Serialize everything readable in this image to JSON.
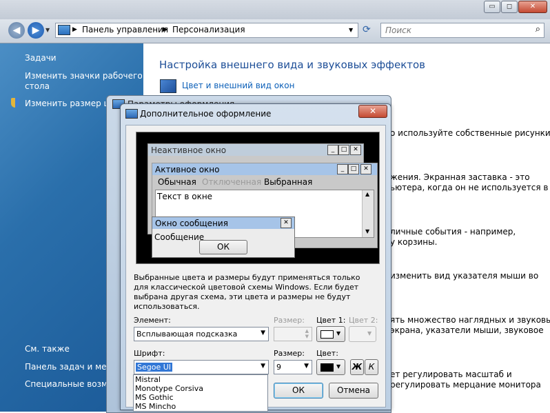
{
  "window": {
    "controls": {
      "minimize": "▭",
      "maximize": "◻",
      "close": "✕"
    }
  },
  "address": {
    "crumbs": [
      "Панель управления",
      "Персонализация"
    ],
    "search_placeholder": "Поиск"
  },
  "sidebar": {
    "items": [
      {
        "label": "Задачи"
      },
      {
        "label": "Изменить значки рабочего"
      },
      {
        "label": "стола"
      },
      {
        "label": "Изменить размер шр"
      },
      {
        "label": "См. также"
      },
      {
        "label": "Панель задач и меню"
      },
      {
        "label": "Специальные возмо"
      }
    ]
  },
  "content": {
    "heading": "Настройка внешнего вида и звуковых эффектов",
    "link": "Цвет и внешний вид окон",
    "texts": [
      "о используйте собственные рисунки",
      "жения. Экранная заставка - это",
      "ьютера, когда он не используется в",
      "личные события - например,",
      "у корзины.",
      "изменить вид указателя мыши во",
      "ять множество наглядных и звуковых",
      "экрана, указатели мыши, звуковое",
      "ет регулировать масштаб и",
      "регулировать мерцание монитора"
    ]
  },
  "dialog_back": {
    "title": "Параметры оформления"
  },
  "dialog": {
    "title": "Дополнительное оформление",
    "close": "✕",
    "preview": {
      "inactive_title": "Неактивное окно",
      "active_title": "Активное окно",
      "menu": [
        "Обычная",
        "Отключенная",
        "Выбранная"
      ],
      "window_text": "Текст в окне",
      "msg_title": "Окно сообщения",
      "msg_text": "Сообщение",
      "ok": "ОК"
    },
    "description": "Выбранные цвета и размеры будут применяться только для классической цветовой схемы Windows. Если будет выбрана другая схема, эти цвета и размеры не будут использоваться.",
    "labels": {
      "element": "Элемент:",
      "size1": "Размер:",
      "color1": "Цвет 1:",
      "color2": "Цвет 2:",
      "font": "Шрифт:",
      "size2": "Размер:",
      "color": "Цвет:"
    },
    "element_value": "Всплывающая подсказка",
    "font_value": "Segoe UI",
    "font_size_value": "9",
    "bold": "Ж",
    "italic": "К",
    "font_list": [
      "Mistral",
      "Monotype Corsiva",
      "MS Gothic",
      "MS Mincho"
    ],
    "ok": "ОК",
    "cancel": "Отмена"
  },
  "colors": {
    "active_caption": "#a6c4e8",
    "inactive_caption": "#bfcddb",
    "selection": "#3277d6",
    "link": "#0b5fb8"
  }
}
